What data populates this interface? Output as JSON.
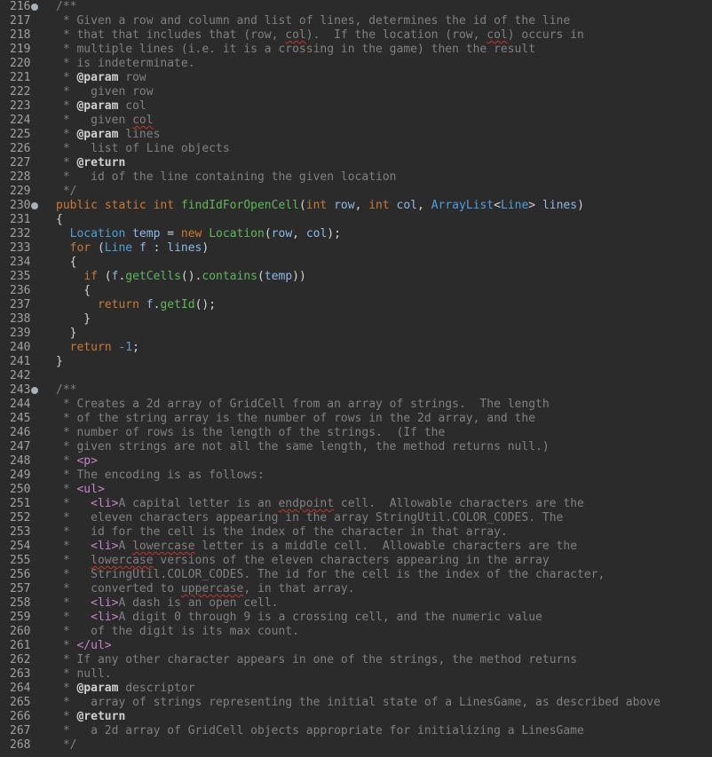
{
  "editor": {
    "colors": {
      "background": "#2b2b2b",
      "comment": "#808080",
      "keyword": "#cc7832",
      "type": "#4ea0d8",
      "method": "#5db85a",
      "tag": "#c586c0"
    },
    "lines": [
      {
        "n": "216",
        "fold": true,
        "segs": [
          {
            "c": "comment",
            "t": "/**"
          }
        ]
      },
      {
        "n": "217",
        "segs": [
          {
            "c": "comment",
            "t": " * Given a row and column and list of lines, determines the id of the line"
          }
        ]
      },
      {
        "n": "218",
        "segs": [
          {
            "c": "comment",
            "t": " * that that includes that (row, "
          },
          {
            "c": "comment uline",
            "t": "col"
          },
          {
            "c": "comment",
            "t": ").  If the location (row, "
          },
          {
            "c": "comment uline",
            "t": "col"
          },
          {
            "c": "comment",
            "t": ") occurs in"
          }
        ]
      },
      {
        "n": "219",
        "segs": [
          {
            "c": "comment",
            "t": " * multiple lines (i.e. it is a crossing in the game) then the result"
          }
        ]
      },
      {
        "n": "220",
        "segs": [
          {
            "c": "comment",
            "t": " * is indeterminate."
          }
        ]
      },
      {
        "n": "221",
        "segs": [
          {
            "c": "comment",
            "t": " * "
          },
          {
            "c": "ann",
            "t": "@param"
          },
          {
            "c": "comment",
            "t": " row"
          }
        ]
      },
      {
        "n": "222",
        "segs": [
          {
            "c": "comment",
            "t": " *   given row"
          }
        ]
      },
      {
        "n": "223",
        "segs": [
          {
            "c": "comment",
            "t": " * "
          },
          {
            "c": "ann",
            "t": "@param"
          },
          {
            "c": "comment",
            "t": " col"
          }
        ]
      },
      {
        "n": "224",
        "segs": [
          {
            "c": "comment",
            "t": " *   given "
          },
          {
            "c": "comment uline",
            "t": "col"
          }
        ]
      },
      {
        "n": "225",
        "segs": [
          {
            "c": "comment",
            "t": " * "
          },
          {
            "c": "ann",
            "t": "@param"
          },
          {
            "c": "comment",
            "t": " lines"
          }
        ]
      },
      {
        "n": "226",
        "segs": [
          {
            "c": "comment",
            "t": " *   list of Line objects"
          }
        ]
      },
      {
        "n": "227",
        "segs": [
          {
            "c": "comment",
            "t": " * "
          },
          {
            "c": "ann",
            "t": "@return"
          }
        ]
      },
      {
        "n": "228",
        "segs": [
          {
            "c": "comment",
            "t": " *   id of the line containing the given location"
          }
        ]
      },
      {
        "n": "229",
        "segs": [
          {
            "c": "comment",
            "t": " */"
          }
        ]
      },
      {
        "n": "230",
        "fold": true,
        "segs": [
          {
            "c": "kw",
            "t": "public static int "
          },
          {
            "c": "method",
            "t": "findIdForOpenCell"
          },
          {
            "c": "plain",
            "t": "("
          },
          {
            "c": "kw",
            "t": "int "
          },
          {
            "c": "var",
            "t": "row"
          },
          {
            "c": "plain",
            "t": ", "
          },
          {
            "c": "kw",
            "t": "int "
          },
          {
            "c": "var",
            "t": "col"
          },
          {
            "c": "plain",
            "t": ", "
          },
          {
            "c": "type",
            "t": "ArrayList"
          },
          {
            "c": "plain",
            "t": "<"
          },
          {
            "c": "type",
            "t": "Line"
          },
          {
            "c": "plain",
            "t": "> "
          },
          {
            "c": "var",
            "t": "lines"
          },
          {
            "c": "plain",
            "t": ")"
          }
        ]
      },
      {
        "n": "231",
        "segs": [
          {
            "c": "plain",
            "t": "{"
          }
        ]
      },
      {
        "n": "232",
        "segs": [
          {
            "c": "plain",
            "t": "  "
          },
          {
            "c": "type",
            "t": "Location"
          },
          {
            "c": "plain",
            "t": " "
          },
          {
            "c": "var",
            "t": "temp"
          },
          {
            "c": "plain",
            "t": " = "
          },
          {
            "c": "kw",
            "t": "new "
          },
          {
            "c": "method",
            "t": "Location"
          },
          {
            "c": "plain",
            "t": "("
          },
          {
            "c": "var",
            "t": "row"
          },
          {
            "c": "plain",
            "t": ", "
          },
          {
            "c": "var",
            "t": "col"
          },
          {
            "c": "plain",
            "t": ");"
          }
        ]
      },
      {
        "n": "233",
        "segs": [
          {
            "c": "plain",
            "t": "  "
          },
          {
            "c": "kw",
            "t": "for"
          },
          {
            "c": "plain",
            "t": " ("
          },
          {
            "c": "type",
            "t": "Line"
          },
          {
            "c": "plain",
            "t": " "
          },
          {
            "c": "var",
            "t": "f"
          },
          {
            "c": "plain",
            "t": " : "
          },
          {
            "c": "var",
            "t": "lines"
          },
          {
            "c": "plain",
            "t": ")"
          }
        ]
      },
      {
        "n": "234",
        "segs": [
          {
            "c": "plain",
            "t": "  {"
          }
        ]
      },
      {
        "n": "235",
        "segs": [
          {
            "c": "plain",
            "t": "    "
          },
          {
            "c": "kw",
            "t": "if"
          },
          {
            "c": "plain",
            "t": " ("
          },
          {
            "c": "var",
            "t": "f"
          },
          {
            "c": "plain",
            "t": "."
          },
          {
            "c": "method",
            "t": "getCells"
          },
          {
            "c": "plain",
            "t": "()."
          },
          {
            "c": "method",
            "t": "contains"
          },
          {
            "c": "plain",
            "t": "("
          },
          {
            "c": "var",
            "t": "temp"
          },
          {
            "c": "plain",
            "t": "))"
          }
        ]
      },
      {
        "n": "236",
        "segs": [
          {
            "c": "plain",
            "t": "    {"
          }
        ]
      },
      {
        "n": "237",
        "segs": [
          {
            "c": "plain",
            "t": "      "
          },
          {
            "c": "kw",
            "t": "return "
          },
          {
            "c": "var",
            "t": "f"
          },
          {
            "c": "plain",
            "t": "."
          },
          {
            "c": "method",
            "t": "getId"
          },
          {
            "c": "plain",
            "t": "();"
          }
        ]
      },
      {
        "n": "238",
        "segs": [
          {
            "c": "plain",
            "t": "    }"
          }
        ]
      },
      {
        "n": "239",
        "segs": [
          {
            "c": "plain",
            "t": "  }"
          }
        ]
      },
      {
        "n": "240",
        "segs": [
          {
            "c": "plain",
            "t": "  "
          },
          {
            "c": "kw",
            "t": "return "
          },
          {
            "c": "num-lit",
            "t": "-1"
          },
          {
            "c": "plain",
            "t": ";"
          }
        ]
      },
      {
        "n": "241",
        "segs": [
          {
            "c": "plain",
            "t": "}"
          }
        ]
      },
      {
        "n": "242",
        "segs": []
      },
      {
        "n": "243",
        "fold": true,
        "segs": [
          {
            "c": "comment",
            "t": "/**"
          }
        ]
      },
      {
        "n": "244",
        "segs": [
          {
            "c": "comment",
            "t": " * Creates a 2d array of GridCell from an array of strings.  The length"
          }
        ]
      },
      {
        "n": "245",
        "segs": [
          {
            "c": "comment",
            "t": " * of the string array is the number of rows in the 2d array, and the"
          }
        ]
      },
      {
        "n": "246",
        "segs": [
          {
            "c": "comment",
            "t": " * number of rows is the length of the strings.  (If the"
          }
        ]
      },
      {
        "n": "247",
        "segs": [
          {
            "c": "comment",
            "t": " * given strings are not all the same length, the method returns null.)"
          }
        ]
      },
      {
        "n": "248",
        "segs": [
          {
            "c": "comment",
            "t": " * "
          },
          {
            "c": "tag",
            "t": "<p>"
          }
        ]
      },
      {
        "n": "249",
        "segs": [
          {
            "c": "comment",
            "t": " * The encoding is as follows:"
          }
        ]
      },
      {
        "n": "250",
        "segs": [
          {
            "c": "comment",
            "t": " * "
          },
          {
            "c": "tag",
            "t": "<ul>"
          }
        ]
      },
      {
        "n": "251",
        "segs": [
          {
            "c": "comment",
            "t": " *   "
          },
          {
            "c": "tag",
            "t": "<li>"
          },
          {
            "c": "comment",
            "t": "A capital letter is an "
          },
          {
            "c": "comment uline",
            "t": "endpoint"
          },
          {
            "c": "comment",
            "t": " cell.  Allowable characters are the"
          }
        ]
      },
      {
        "n": "252",
        "segs": [
          {
            "c": "comment",
            "t": " *   eleven characters appearing in the array StringUtil.COLOR_CODES. The"
          }
        ]
      },
      {
        "n": "253",
        "segs": [
          {
            "c": "comment",
            "t": " *   id for the cell is the index of the character in that array."
          }
        ]
      },
      {
        "n": "254",
        "segs": [
          {
            "c": "comment",
            "t": " *   "
          },
          {
            "c": "tag",
            "t": "<li>"
          },
          {
            "c": "comment",
            "t": "A "
          },
          {
            "c": "comment uline",
            "t": "lowercase"
          },
          {
            "c": "comment",
            "t": " letter is a middle cell.  Allowable characters are the"
          }
        ]
      },
      {
        "n": "255",
        "segs": [
          {
            "c": "comment",
            "t": " *   "
          },
          {
            "c": "comment uline",
            "t": "lowercase"
          },
          {
            "c": "comment",
            "t": " versions of the eleven characters appearing in the array"
          }
        ]
      },
      {
        "n": "256",
        "segs": [
          {
            "c": "comment",
            "t": " *   StringUtil.COLOR_CODES. The id for the cell is the index of the character,"
          }
        ]
      },
      {
        "n": "257",
        "segs": [
          {
            "c": "comment",
            "t": " *   converted to "
          },
          {
            "c": "comment uline",
            "t": "uppercase"
          },
          {
            "c": "comment",
            "t": ", in that array."
          }
        ]
      },
      {
        "n": "258",
        "segs": [
          {
            "c": "comment",
            "t": " *   "
          },
          {
            "c": "tag",
            "t": "<li>"
          },
          {
            "c": "comment",
            "t": "A dash is an open cell."
          }
        ]
      },
      {
        "n": "259",
        "segs": [
          {
            "c": "comment",
            "t": " *   "
          },
          {
            "c": "tag",
            "t": "<li>"
          },
          {
            "c": "comment",
            "t": "A digit 0 through 9 is a crossing cell, and the numeric value"
          }
        ]
      },
      {
        "n": "260",
        "segs": [
          {
            "c": "comment",
            "t": " *   of the digit is its max count."
          }
        ]
      },
      {
        "n": "261",
        "segs": [
          {
            "c": "comment",
            "t": " * "
          },
          {
            "c": "tag",
            "t": "</ul>"
          }
        ]
      },
      {
        "n": "262",
        "segs": [
          {
            "c": "comment",
            "t": " * If any other character appears in one of the strings, the method returns"
          }
        ]
      },
      {
        "n": "263",
        "segs": [
          {
            "c": "comment",
            "t": " * null."
          }
        ]
      },
      {
        "n": "264",
        "segs": [
          {
            "c": "comment",
            "t": " * "
          },
          {
            "c": "ann",
            "t": "@param"
          },
          {
            "c": "comment",
            "t": " descriptor"
          }
        ]
      },
      {
        "n": "265",
        "segs": [
          {
            "c": "comment",
            "t": " *   array of strings representing the initial state of a LinesGame, as described above"
          }
        ]
      },
      {
        "n": "266",
        "segs": [
          {
            "c": "comment",
            "t": " * "
          },
          {
            "c": "ann",
            "t": "@return"
          }
        ]
      },
      {
        "n": "267",
        "segs": [
          {
            "c": "comment",
            "t": " *   a 2d array of GridCell objects appropriate for initializing a LinesGame"
          }
        ]
      },
      {
        "n": "268",
        "segs": [
          {
            "c": "comment",
            "t": " */"
          }
        ]
      }
    ]
  }
}
